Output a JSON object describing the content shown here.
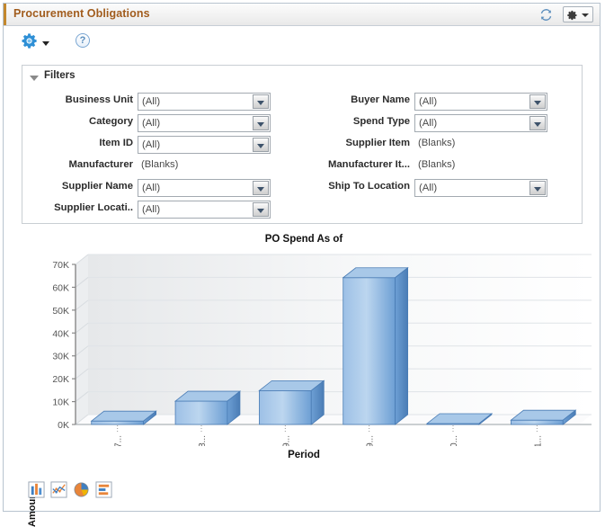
{
  "window": {
    "title": "Procurement Obligations",
    "refresh_icon": "refresh-icon",
    "menu_icon": "gear-icon",
    "menu_caret_icon": "caret-down-icon"
  },
  "toolbar": {
    "actions_icon": "gear-icon",
    "actions_caret_icon": "caret-down-icon",
    "help_label": "?",
    "help_icon": "help-icon"
  },
  "filters": {
    "title": "Filters",
    "collapse_icon": "triangle-down-icon",
    "left_column": [
      {
        "label": "Business Unit",
        "value": "(All)",
        "type": "dropdown"
      },
      {
        "label": "Category",
        "value": "(All)",
        "type": "dropdown"
      },
      {
        "label": "Item ID",
        "value": "(All)",
        "type": "dropdown"
      },
      {
        "label": "Manufacturer",
        "value": "(Blanks)",
        "type": "text"
      },
      {
        "label": "Supplier Name",
        "value": "(All)",
        "type": "dropdown"
      },
      {
        "label": "Supplier Locati..",
        "value": "(All)",
        "type": "dropdown"
      }
    ],
    "right_column": [
      {
        "label": "Buyer Name",
        "value": "(All)",
        "type": "dropdown"
      },
      {
        "label": "Spend Type",
        "value": "(All)",
        "type": "dropdown"
      },
      {
        "label": "Supplier Item",
        "value": "(Blanks)",
        "type": "text"
      },
      {
        "label": "Manufacturer It...",
        "value": "(Blanks)",
        "type": "text"
      },
      {
        "label": "Ship To Location",
        "value": "(All)",
        "type": "dropdown"
      }
    ]
  },
  "chart_data": {
    "type": "bar",
    "title": "PO Spend As of",
    "xlabel": "Period",
    "ylabel": "Amount",
    "categories": [
      "07...",
      "08...",
      "09...",
      "09...",
      "10...",
      "11..."
    ],
    "values": [
      1500,
      10200,
      14800,
      64200,
      400,
      1900
    ],
    "ytick_labels": [
      "0K",
      "10K",
      "20K",
      "30K",
      "40K",
      "50K",
      "60K",
      "70K"
    ],
    "ytick_values": [
      0,
      10000,
      20000,
      30000,
      40000,
      50000,
      60000,
      70000
    ],
    "ylim": [
      0,
      70000
    ],
    "grid": true,
    "legend": "none",
    "bar_color": "#7ba7d7",
    "bar_color_dark": "#3f6fae",
    "bar_color_light": "#cfe0f2"
  },
  "chart_types": [
    {
      "name": "vertical-bar-chart-icon",
      "label": "Bar Chart"
    },
    {
      "name": "line-chart-icon",
      "label": "Line Chart"
    },
    {
      "name": "pie-chart-icon",
      "label": "Pie Chart"
    },
    {
      "name": "horizontal-bar-chart-icon",
      "label": "Horizontal Bar Chart"
    }
  ]
}
